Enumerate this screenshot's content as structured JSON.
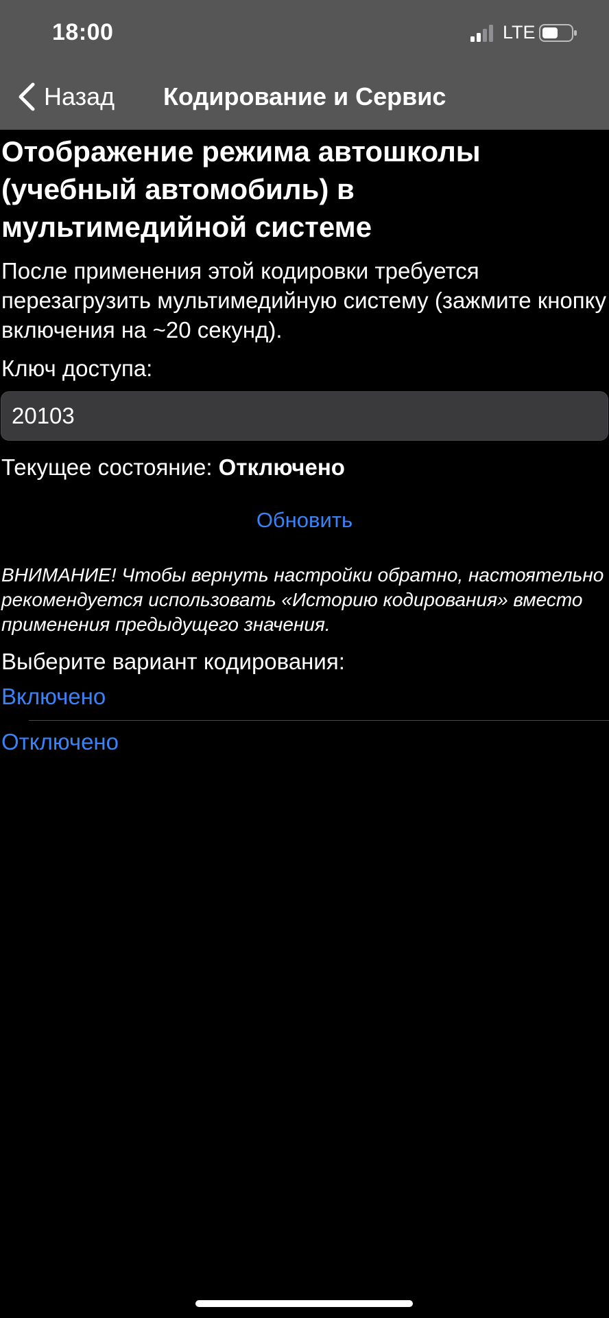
{
  "status_bar": {
    "time": "18:00",
    "network": "LTE",
    "signal_icon": "signal-bars-icon",
    "battery_icon": "battery-icon"
  },
  "nav": {
    "back_label": "Назад",
    "back_icon": "chevron-left-icon",
    "title": "Кодирование и Сервис"
  },
  "page": {
    "title": "Отображение режима автошколы (учебный автомобиль) в мультимедийной системе",
    "description": "После применения этой кодировки требуется перезагрузить мультимедийную систему (зажмите кнопку включения на ~20 секунд).",
    "key_label": "Ключ доступа:",
    "key_value": "20103",
    "state_label": "Текущее состояние:",
    "state_value": "Отключено",
    "refresh_label": "Обновить",
    "warning": "ВНИМАНИЕ! Чтобы вернуть настройки обратно, настоятельно рекомендуется использовать «Историю кодирования» вместо применения предыдущего значения.",
    "choose_label": "Выберите вариант кодирования:",
    "options": [
      {
        "label": "Включено"
      },
      {
        "label": "Отключено"
      }
    ]
  },
  "colors": {
    "background": "#000000",
    "nav_background": "#565656",
    "accent": "#3a82f7",
    "input_background": "#3a3a3c"
  }
}
